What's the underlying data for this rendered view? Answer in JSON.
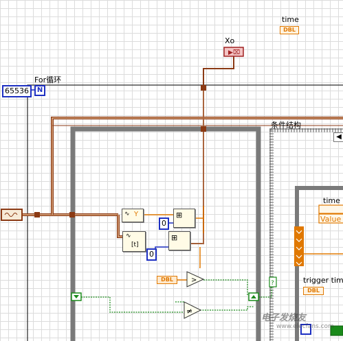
{
  "indicators": {
    "time_label": "time",
    "time_type": "DBL",
    "xo_label": "Xo"
  },
  "for_loop": {
    "label": "For循环",
    "count_value": "65536",
    "count_terminal": "N"
  },
  "case_structure": {
    "label": "条件结构"
  },
  "build_array_nodes": {
    "y_label": "Y",
    "t_label": "[t]"
  },
  "constants": {
    "zero_a": "0",
    "zero_b": "0",
    "dbl_control": "DBL"
  },
  "inner_case": {
    "time_label": "time",
    "value_label": "Value",
    "trigger_label": "trigger time",
    "trigger_type": "DBL"
  },
  "watermark": {
    "brand": "电子发烧友",
    "site": "www.elecfans.com"
  },
  "colors": {
    "dbl_wire": "#e07800",
    "waveform_wire": "#8b3a14",
    "bool_wire": "#1a8a1a",
    "int_wire": "#1d2fc2",
    "structure_frame": "#7a7a7a"
  }
}
